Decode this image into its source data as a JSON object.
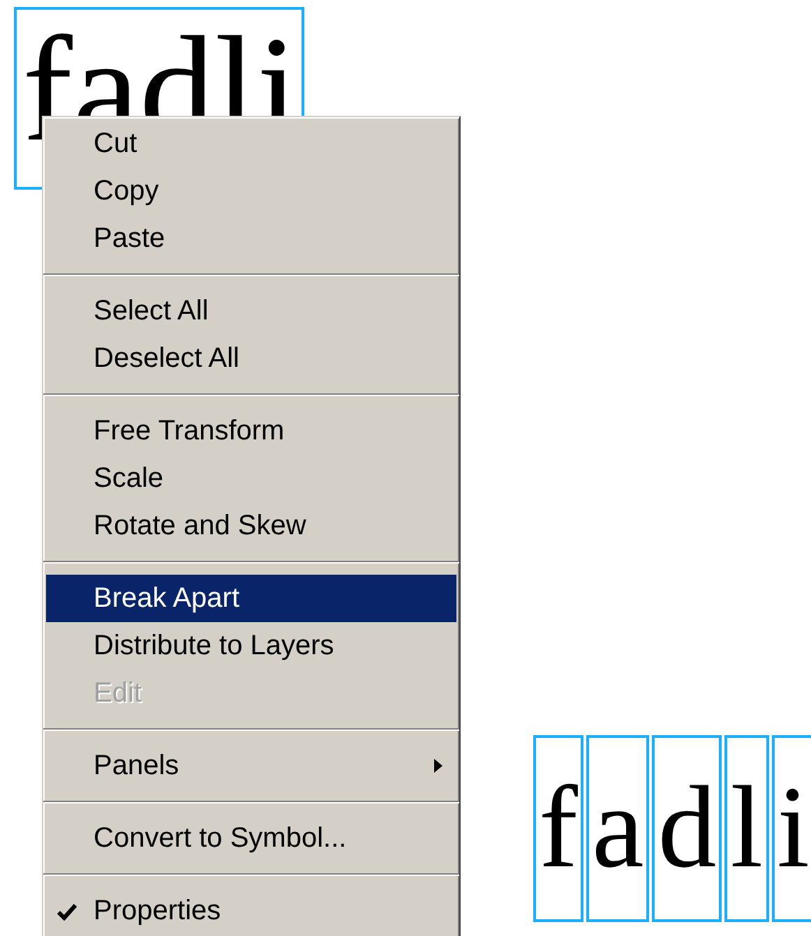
{
  "text_object": {
    "text": "fadli"
  },
  "broken_apart": {
    "letters": [
      "f",
      "a",
      "d",
      "l",
      "i"
    ]
  },
  "context_menu": {
    "items": [
      {
        "kind": "item",
        "label": "Cut",
        "selected": false,
        "disabled": false,
        "checked": false,
        "submenu": false
      },
      {
        "kind": "item",
        "label": "Copy",
        "selected": false,
        "disabled": false,
        "checked": false,
        "submenu": false
      },
      {
        "kind": "item",
        "label": "Paste",
        "selected": false,
        "disabled": false,
        "checked": false,
        "submenu": false
      },
      {
        "kind": "separator"
      },
      {
        "kind": "item",
        "label": "Select All",
        "selected": false,
        "disabled": false,
        "checked": false,
        "submenu": false
      },
      {
        "kind": "item",
        "label": "Deselect All",
        "selected": false,
        "disabled": false,
        "checked": false,
        "submenu": false
      },
      {
        "kind": "separator"
      },
      {
        "kind": "item",
        "label": "Free Transform",
        "selected": false,
        "disabled": false,
        "checked": false,
        "submenu": false
      },
      {
        "kind": "item",
        "label": "Scale",
        "selected": false,
        "disabled": false,
        "checked": false,
        "submenu": false
      },
      {
        "kind": "item",
        "label": "Rotate and Skew",
        "selected": false,
        "disabled": false,
        "checked": false,
        "submenu": false
      },
      {
        "kind": "separator"
      },
      {
        "kind": "item",
        "label": "Break Apart",
        "selected": true,
        "disabled": false,
        "checked": false,
        "submenu": false
      },
      {
        "kind": "item",
        "label": "Distribute to Layers",
        "selected": false,
        "disabled": false,
        "checked": false,
        "submenu": false
      },
      {
        "kind": "item",
        "label": "Edit",
        "selected": false,
        "disabled": true,
        "checked": false,
        "submenu": false
      },
      {
        "kind": "separator"
      },
      {
        "kind": "item",
        "label": "Panels",
        "selected": false,
        "disabled": false,
        "checked": false,
        "submenu": true
      },
      {
        "kind": "separator"
      },
      {
        "kind": "item",
        "label": "Convert to Symbol...",
        "selected": false,
        "disabled": false,
        "checked": false,
        "submenu": false
      },
      {
        "kind": "separator"
      },
      {
        "kind": "item",
        "label": "Properties",
        "selected": false,
        "disabled": false,
        "checked": true,
        "submenu": false
      }
    ]
  }
}
